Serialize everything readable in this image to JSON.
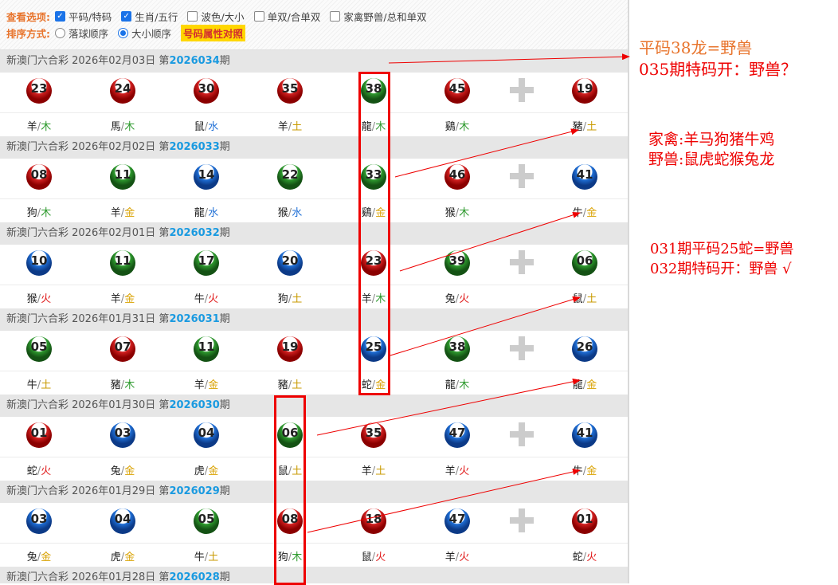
{
  "options": {
    "view_label": "查看选项:",
    "view_opts": [
      {
        "label": "平码/特码",
        "checked": true
      },
      {
        "label": "生肖/五行",
        "checked": true
      },
      {
        "label": "波色/大小",
        "checked": false
      },
      {
        "label": "单双/合单双",
        "checked": false
      },
      {
        "label": "家禽野兽/总和单双",
        "checked": false
      }
    ],
    "sort_label": "排序方式:",
    "sort_opts": [
      {
        "label": "落球顺序",
        "selected": false
      },
      {
        "label": "大小顺序",
        "selected": true
      }
    ],
    "attr_button": "号码属性对照"
  },
  "draws": [
    {
      "title": "新澳门六合彩 2026年02月03日 第",
      "period": "2026034",
      "period_suffix": "期",
      "balls": [
        {
          "n": "23",
          "c": "red",
          "z": "羊",
          "e": "木"
        },
        {
          "n": "24",
          "c": "red",
          "z": "馬",
          "e": "木"
        },
        {
          "n": "30",
          "c": "red",
          "z": "鼠",
          "e": "水"
        },
        {
          "n": "35",
          "c": "red",
          "z": "羊",
          "e": "土"
        },
        {
          "n": "38",
          "c": "green",
          "z": "龍",
          "e": "木"
        },
        {
          "n": "45",
          "c": "red",
          "z": "鷄",
          "e": "木"
        }
      ],
      "special": {
        "n": "19",
        "c": "red",
        "z": "豬",
        "e": "土"
      }
    },
    {
      "title": "新澳门六合彩 2026年02月02日 第",
      "period": "2026033",
      "period_suffix": "期",
      "balls": [
        {
          "n": "08",
          "c": "red",
          "z": "狗",
          "e": "木"
        },
        {
          "n": "11",
          "c": "green",
          "z": "羊",
          "e": "金"
        },
        {
          "n": "14",
          "c": "blue",
          "z": "龍",
          "e": "水"
        },
        {
          "n": "22",
          "c": "green",
          "z": "猴",
          "e": "水"
        },
        {
          "n": "33",
          "c": "green",
          "z": "鷄",
          "e": "金"
        },
        {
          "n": "46",
          "c": "red",
          "z": "猴",
          "e": "木"
        }
      ],
      "special": {
        "n": "41",
        "c": "blue",
        "z": "牛",
        "e": "金"
      }
    },
    {
      "title": "新澳门六合彩 2026年02月01日 第",
      "period": "2026032",
      "period_suffix": "期",
      "balls": [
        {
          "n": "10",
          "c": "blue",
          "z": "猴",
          "e": "火"
        },
        {
          "n": "11",
          "c": "green",
          "z": "羊",
          "e": "金"
        },
        {
          "n": "17",
          "c": "green",
          "z": "牛",
          "e": "火"
        },
        {
          "n": "20",
          "c": "blue",
          "z": "狗",
          "e": "土"
        },
        {
          "n": "23",
          "c": "red",
          "z": "羊",
          "e": "木"
        },
        {
          "n": "39",
          "c": "green",
          "z": "兔",
          "e": "火"
        }
      ],
      "special": {
        "n": "06",
        "c": "green",
        "z": "鼠",
        "e": "土"
      }
    },
    {
      "title": "新澳门六合彩 2026年01月31日 第",
      "period": "2026031",
      "period_suffix": "期",
      "balls": [
        {
          "n": "05",
          "c": "green",
          "z": "牛",
          "e": "土"
        },
        {
          "n": "07",
          "c": "red",
          "z": "豬",
          "e": "木"
        },
        {
          "n": "11",
          "c": "green",
          "z": "羊",
          "e": "金"
        },
        {
          "n": "19",
          "c": "red",
          "z": "豬",
          "e": "土"
        },
        {
          "n": "25",
          "c": "blue",
          "z": "蛇",
          "e": "金"
        },
        {
          "n": "38",
          "c": "green",
          "z": "龍",
          "e": "木"
        }
      ],
      "special": {
        "n": "26",
        "c": "blue",
        "z": "龍",
        "e": "金"
      }
    },
    {
      "title": "新澳门六合彩 2026年01月30日 第",
      "period": "2026030",
      "period_suffix": "期",
      "balls": [
        {
          "n": "01",
          "c": "red",
          "z": "蛇",
          "e": "火"
        },
        {
          "n": "03",
          "c": "blue",
          "z": "兔",
          "e": "金"
        },
        {
          "n": "04",
          "c": "blue",
          "z": "虎",
          "e": "金"
        },
        {
          "n": "06",
          "c": "green",
          "z": "鼠",
          "e": "土"
        },
        {
          "n": "35",
          "c": "red",
          "z": "羊",
          "e": "土"
        },
        {
          "n": "47",
          "c": "blue",
          "z": "羊",
          "e": "火"
        }
      ],
      "special": {
        "n": "41",
        "c": "blue",
        "z": "牛",
        "e": "金"
      }
    },
    {
      "title": "新澳门六合彩 2026年01月29日 第",
      "period": "2026029",
      "period_suffix": "期",
      "balls": [
        {
          "n": "03",
          "c": "blue",
          "z": "兔",
          "e": "金"
        },
        {
          "n": "04",
          "c": "blue",
          "z": "虎",
          "e": "金"
        },
        {
          "n": "05",
          "c": "green",
          "z": "牛",
          "e": "土"
        },
        {
          "n": "08",
          "c": "red",
          "z": "狗",
          "e": "木"
        },
        {
          "n": "18",
          "c": "red",
          "z": "鼠",
          "e": "火"
        },
        {
          "n": "47",
          "c": "blue",
          "z": "羊",
          "e": "火"
        }
      ],
      "special": {
        "n": "01",
        "c": "red",
        "z": "蛇",
        "e": "火"
      }
    },
    {
      "title": "新澳门六合彩 2026年01月28日 第",
      "period": "2026028",
      "period_suffix": "期",
      "balls": [],
      "special": null
    }
  ],
  "notes": [
    "平码38龙=野兽",
    "035期特码开：野兽？",
    "家禽:羊马狗猪牛鸡",
    "野兽:鼠虎蛇猴兔龙",
    "031期平码25蛇=野兽",
    "032期特码开：野兽 √"
  ]
}
